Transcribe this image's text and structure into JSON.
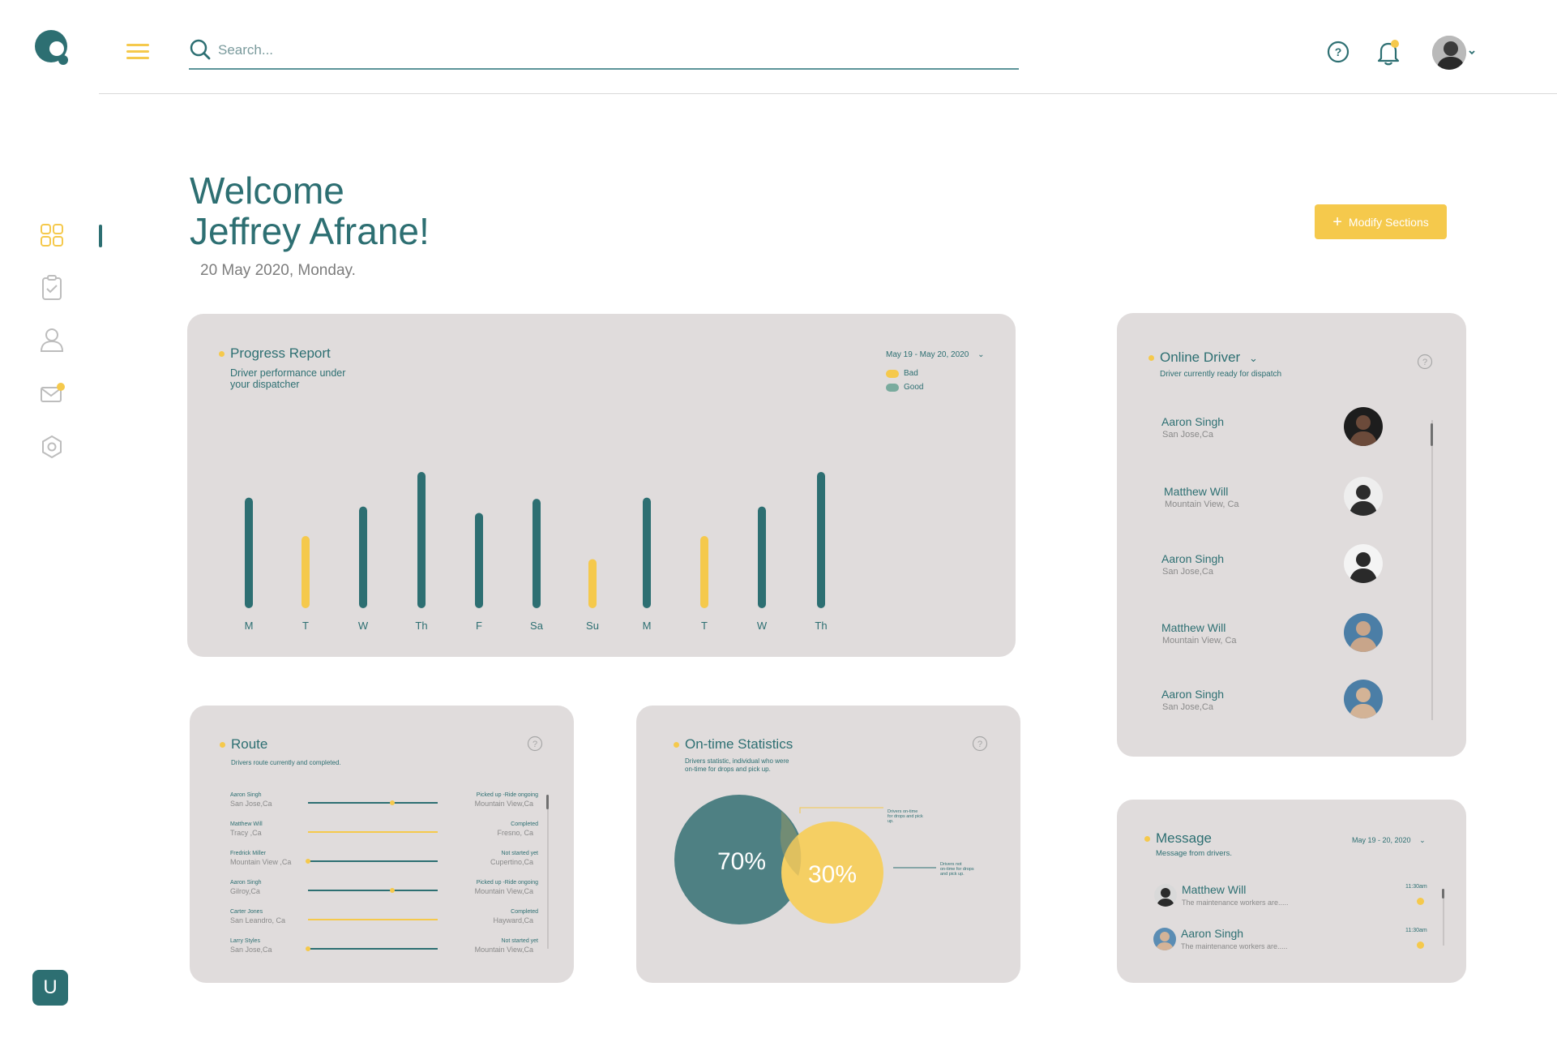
{
  "app": {
    "logo_icon": "logo-icon",
    "accent": "#f5c94c",
    "primary": "#2d6f72",
    "card_bg": "#e0dcdc"
  },
  "header": {
    "search_placeholder": "Search...",
    "help_icon": "question-circle-icon",
    "bell_icon": "bell-icon",
    "avatar_icon": "user-avatar"
  },
  "sidebar": {
    "items": [
      {
        "name": "dashboard",
        "icon": "grid-icon",
        "active": true
      },
      {
        "name": "tasks",
        "icon": "clipboard-check-icon"
      },
      {
        "name": "drivers",
        "icon": "user-icon"
      },
      {
        "name": "messages",
        "icon": "mail-icon",
        "badge": true
      },
      {
        "name": "settings",
        "icon": "hexagon-gear-icon"
      }
    ],
    "user_initial": "U"
  },
  "welcome": {
    "line1": "Welcome",
    "line2": "Jeffrey Afrane!",
    "date": "20 May 2020, Monday.",
    "modify_label": "Modify Sections"
  },
  "progress_report": {
    "title": "Progress Report",
    "subtitle_line1": "Driver performance under",
    "subtitle_line2": "your dispatcher",
    "date_range": "May 19 - May 20, 2020",
    "legend": [
      {
        "label": "Bad",
        "color": "#f5c94c"
      },
      {
        "label": "Good",
        "color": "#7aab9e"
      }
    ]
  },
  "chart_data": {
    "type": "bar",
    "title": "Progress Report",
    "categories": [
      "M",
      "T",
      "W",
      "Th",
      "F",
      "Sa",
      "Su",
      "M",
      "T",
      "W",
      "Th"
    ],
    "values": [
      0.8,
      0.5,
      0.73,
      1.0,
      0.68,
      0.79,
      0.32,
      0.8,
      0.5,
      0.73,
      1.0
    ],
    "ratings": [
      "Good",
      "Bad",
      "Good",
      "Good",
      "Good",
      "Good",
      "Bad",
      "Good",
      "Bad",
      "Good",
      "Good"
    ],
    "colors": {
      "Good": "#2d6f72",
      "Bad": "#f5c94c"
    },
    "ylim": [
      0,
      1
    ]
  },
  "route": {
    "title": "Route",
    "subtitle": "Drivers route currently and completed.",
    "rows": [
      {
        "name": "Aaron Singh",
        "from": "San Jose,Ca",
        "status": "Picked up -Ride ongoing",
        "to": "Mountain View,Ca",
        "progress": 0.65,
        "line": "teal"
      },
      {
        "name": "Matthew Will",
        "from": "Tracy ,Ca",
        "status": "Completed",
        "to": "Fresno, Ca",
        "progress": 1.0,
        "line": "yellow"
      },
      {
        "name": "Fredrick Miller",
        "from": "Mountain View ,Ca",
        "status": "Not  started yet",
        "to": "Cupertino,Ca",
        "progress": 0.0,
        "line": "teal"
      },
      {
        "name": "Aaron Singh",
        "from": "Gilroy,Ca",
        "status": "Picked up -Ride ongoing",
        "to": "Mountain View,Ca",
        "progress": 0.65,
        "line": "teal"
      },
      {
        "name": "Carter Jones",
        "from": "San Leandro, Ca",
        "status": "Completed",
        "to": "Hayward,Ca",
        "progress": 1.0,
        "line": "yellow"
      },
      {
        "name": "Larry Styles",
        "from": "San Jose,Ca",
        "status": "Not  started yet",
        "to": "Mountain View,Ca",
        "progress": 0.0,
        "line": "teal"
      }
    ]
  },
  "ontime": {
    "title": "On-time Statistics",
    "subtitle_line1": "Drivers statistic, individual who were",
    "subtitle_line2": "on-time for drops and pick up.",
    "on_time_pct": "70%",
    "not_on_time_pct": "30%",
    "on_time_note": [
      "Drivers on-time",
      "for drops and pick",
      "up."
    ],
    "not_on_time_note": [
      "Drivers not",
      "on-time for drops",
      "and pick up."
    ]
  },
  "online_driver": {
    "title": "Online Driver",
    "subtitle": "Driver currently ready for dispatch",
    "drivers": [
      {
        "name": "Aaron Singh",
        "location": "San Jose,Ca"
      },
      {
        "name": "Matthew Will",
        "location": "Mountain View, Ca"
      },
      {
        "name": "Aaron Singh",
        "location": "San Jose,Ca"
      },
      {
        "name": "Matthew Will",
        "location": "Mountain View, Ca"
      },
      {
        "name": "Aaron Singh",
        "location": "San Jose,Ca"
      }
    ]
  },
  "message": {
    "title": "Message",
    "subtitle": "Message from drivers.",
    "date_range": "May 19 - 20, 2020",
    "items": [
      {
        "name": "Matthew Will",
        "text": "The maintenance workers are.....",
        "time": "11:30am"
      },
      {
        "name": "Aaron Singh",
        "text": "The maintenance workers are.....",
        "time": "11:30am"
      }
    ]
  }
}
